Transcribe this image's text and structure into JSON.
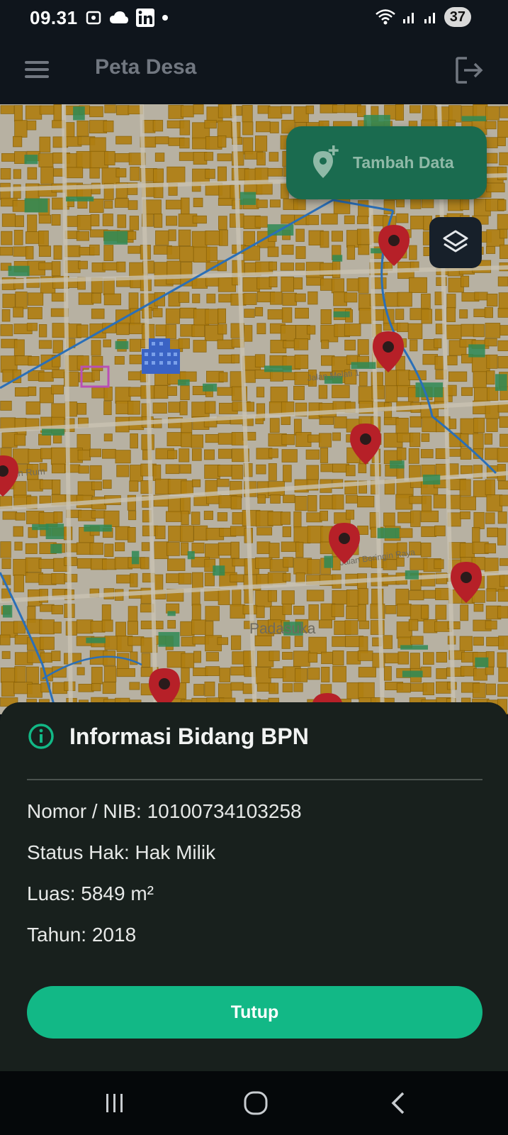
{
  "status_bar": {
    "time": "09.31",
    "battery": "37"
  },
  "app_bar": {
    "title": "Peta Desa"
  },
  "map": {
    "add_button_label": "Tambah Data",
    "street_labels": [
      "Padasuka",
      "Jalan Melati 1",
      "Jalan Beringin Raya",
      "Jalan Rum"
    ],
    "colors": {
      "parcel": "#b07f12",
      "parcel_border": "#8a6208",
      "road": "#c9c3b3",
      "green": "#2f8a55",
      "river": "#2a6fb8",
      "marker": "#b62028"
    }
  },
  "info_sheet": {
    "title": "Informasi Bidang BPN",
    "rows": [
      "Nomor / NIB: 10100734103258",
      "Status Hak: Hak Milik",
      "Luas: 5849 m²",
      "Tahun: 2018"
    ],
    "close_label": "Tutup"
  },
  "nav_bar": {
    "icons": [
      "recent-apps-icon",
      "home-icon",
      "back-icon"
    ]
  }
}
